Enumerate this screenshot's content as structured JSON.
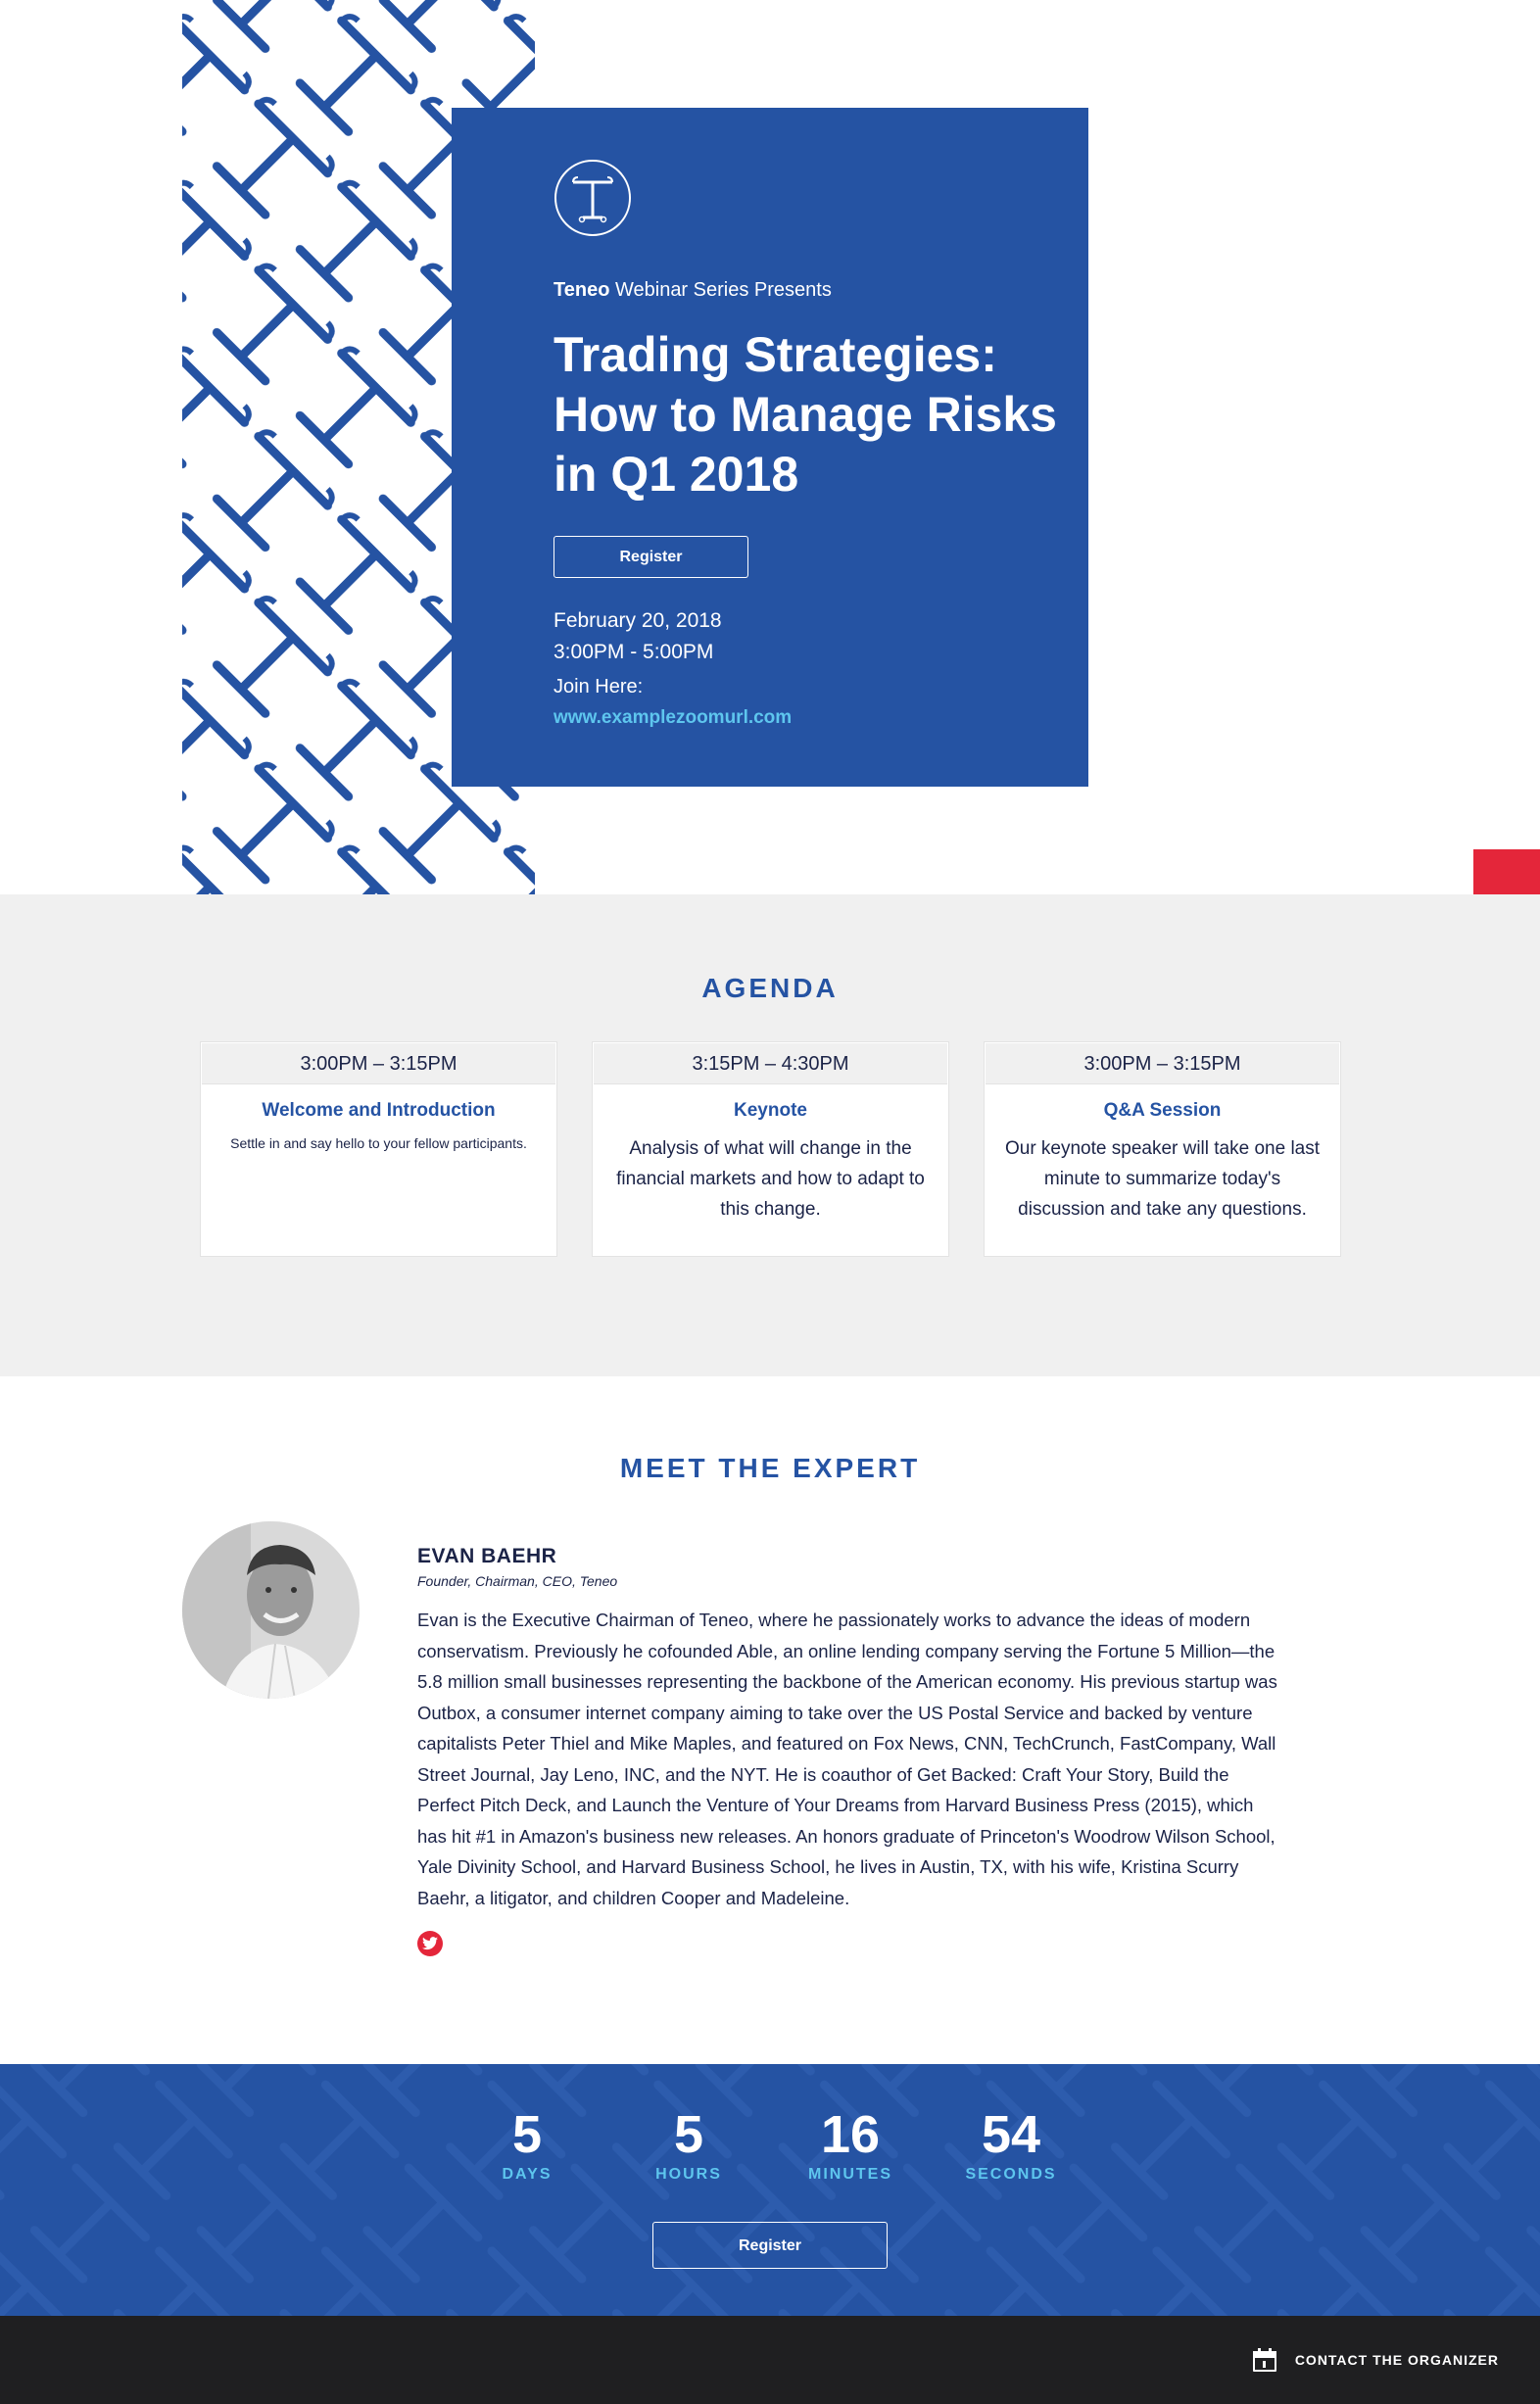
{
  "colors": {
    "brand_blue": "#2553a3",
    "accent_cyan": "#5ec6ee",
    "accent_red": "#e4263a",
    "dark": "#1f1f21",
    "light_gray": "#f0f0f0"
  },
  "hero": {
    "brand": "Teneo",
    "presents": "Webinar Series Presents",
    "title_lines": [
      "Trading Strategies:",
      "How to Manage Risks",
      "in Q1 2018"
    ],
    "register_label": "Register",
    "date": "February 20, 2018",
    "time": "3:00PM - 5:00PM",
    "join_label": "Join Here:",
    "join_url": "www.examplezoomurl.com"
  },
  "agenda": {
    "title": "AGENDA",
    "items": [
      {
        "time": "3:00PM – 3:15PM",
        "heading": "Welcome and Introduction",
        "body": "Settle in and say hello to your fellow participants."
      },
      {
        "time": "3:15PM – 4:30PM",
        "heading": "Keynote",
        "body": "Analysis of what will change in the financial markets and how to adapt to this change."
      },
      {
        "time": "3:00PM – 3:15PM",
        "heading": "Q&A Session",
        "body": "Our keynote speaker will take one last minute to summarize today's discussion and take any questions."
      }
    ]
  },
  "expert": {
    "title": "MEET THE EXPERT",
    "name": "EVAN BAEHR",
    "role": "Founder, Chairman, CEO, Teneo",
    "bio": "Evan is the Executive Chairman of Teneo, where he passionately works to advance the ideas of modern conservatism. Previously he cofounded Able, an online lending company serving the Fortune 5 Million—the 5.8 million small businesses representing the backbone of the American economy. His previous startup was Outbox, a consumer internet company aiming to take over the US Postal Service and backed by venture capitalists Peter Thiel and Mike Maples, and featured on Fox News, CNN, TechCrunch, FastCompany, Wall Street Journal, Jay Leno, INC, and the NYT. He is coauthor of Get Backed: Craft Your Story, Build the Perfect Pitch Deck, and Launch the Venture of Your Dreams from Harvard Business Press (2015), which has hit #1 in Amazon's business new releases. An honors graduate of Princeton's Woodrow Wilson School, Yale Divinity School, and Harvard Business School, he lives in Austin, TX, with his wife, Kristina Scurry Baehr, a litigator, and children Cooper and Madeleine.",
    "social_icon": "twitter-icon"
  },
  "countdown": {
    "units": [
      {
        "value": "5",
        "label": "DAYS"
      },
      {
        "value": "5",
        "label": "HOURS"
      },
      {
        "value": "16",
        "label": "MINUTES"
      },
      {
        "value": "54",
        "label": "SECONDS"
      }
    ],
    "register_label": "Register"
  },
  "footer": {
    "contact_label": "CONTACT THE ORGANIZER",
    "contact_icon": "calendar-icon"
  }
}
